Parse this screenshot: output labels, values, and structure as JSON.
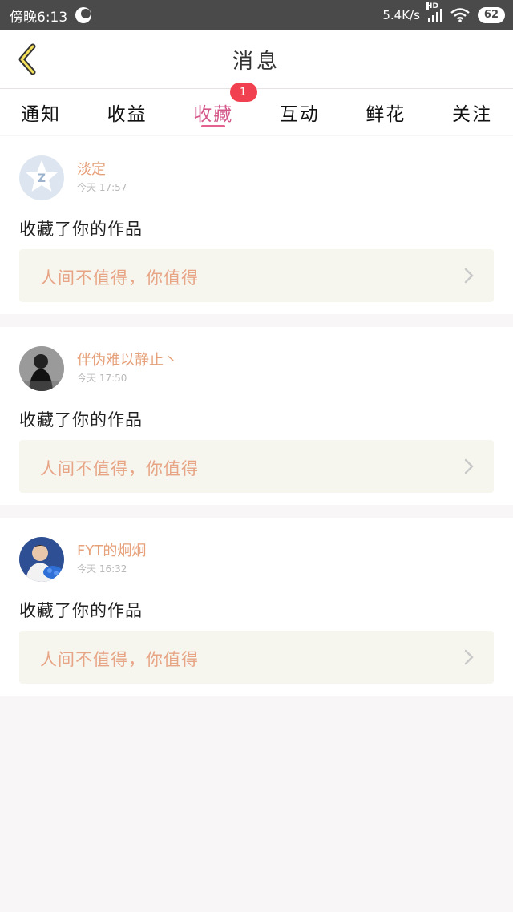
{
  "status_bar": {
    "time": "傍晚6:13",
    "network_speed": "5.4K/s",
    "network_badge": "HD",
    "battery": "62"
  },
  "header": {
    "title": "消息"
  },
  "tabs": [
    {
      "label": "通知"
    },
    {
      "label": "收益"
    },
    {
      "label": "收藏",
      "badge": "1",
      "active": true
    },
    {
      "label": "互动"
    },
    {
      "label": "鲜花"
    },
    {
      "label": "关注"
    }
  ],
  "messages": [
    {
      "username": "淡定",
      "timestamp": "今天 17:57",
      "action": "收藏了你的作品",
      "work_title": "人间不值得，你值得"
    },
    {
      "username": "伴伪难以静止丶",
      "timestamp": "今天 17:50",
      "action": "收藏了你的作品",
      "work_title": "人间不值得，你值得"
    },
    {
      "username": "FYT的炯炯",
      "timestamp": "今天 16:32",
      "action": "收藏了你的作品",
      "work_title": "人间不值得，你值得"
    }
  ],
  "colors": {
    "accent": "#e4608f",
    "badge": "#f1404f",
    "username": "#e6a17a",
    "link_bg": "#f6f5ee"
  }
}
